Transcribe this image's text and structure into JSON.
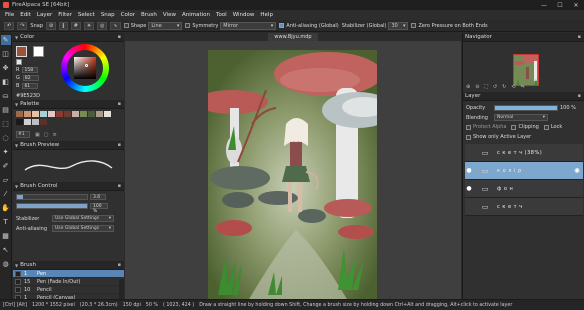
{
  "window": {
    "title": "FireAlpaca SE [64bit]",
    "minimize": "—",
    "maximize": "☐",
    "close": "✕"
  },
  "menu": [
    "File",
    "Edit",
    "Layer",
    "Filter",
    "Select",
    "Snap",
    "Color",
    "Brush",
    "View",
    "Animation",
    "Tool",
    "Window",
    "Help"
  ],
  "toolbar": {
    "snap_label": "Snap",
    "shape_label": "Shape",
    "shape_value": "Line",
    "symmetry_label": "Symmetry",
    "symmetry_value": "Mirror",
    "antialias_label": "Anti-aliasing (Global)",
    "stabilizer_label": "Stabilizer (Global)",
    "stabilizer_value": "30",
    "zero_pressure_label": "Zero Pressure on Both Ends"
  },
  "color_panel": {
    "title": "Color",
    "r_label": "R",
    "r_value": "158",
    "g_label": "G",
    "g_value": "82",
    "b_label": "B",
    "b_value": "61",
    "hex": "#9E523D",
    "fg_color": "#9e523d",
    "bg_color": "#ffffff"
  },
  "palette_panel": {
    "title": "Palette",
    "select_value": "#1",
    "row1": [
      "#9b6a4a",
      "#c99574",
      "#e8c3a6",
      "#a5d1d9",
      "#e3c7c2",
      "#8a3a33",
      "#6b3d2e",
      "#c6b0a8",
      "#7a8a55",
      "#4a5a3a",
      "#a89b8a",
      "#e6e1da"
    ],
    "row2": [
      "#1a1a1a",
      "#d0d0d0",
      "#bfbfbf",
      "#5b2f2a"
    ]
  },
  "brush_preview": {
    "title": "Brush Preview"
  },
  "brush_control": {
    "title": "Brush Control",
    "size_value": "3.6",
    "opacity_value": "100 %",
    "stabilizer_label": "Stabilizer",
    "stabilizer_value": "Use Global Settings",
    "antialias_label": "Anti-aliasing",
    "antialias_value": "Use Global Settings"
  },
  "brush_panel": {
    "title": "Brush",
    "items": [
      {
        "size": "1",
        "name": "Pen",
        "selected": true
      },
      {
        "size": "15",
        "name": "Pen (Fade In/Out)",
        "selected": false
      },
      {
        "size": "10",
        "name": "Pencil",
        "selected": false
      },
      {
        "size": "1",
        "name": "Pencil (Canvas)",
        "selected": false
      }
    ]
  },
  "canvas": {
    "tab_label": "www.Bjyu.mdp"
  },
  "navigator": {
    "title": "Navigator"
  },
  "layer_panel": {
    "title": "Layer",
    "opacity_label": "Opacity",
    "opacity_value": "100 %",
    "blending_label": "Blending",
    "blending_value": "Normal",
    "protect_alpha_label": "Protect Alpha",
    "clipping_label": "Clipping",
    "lock_label": "Lock",
    "show_only_active_label": "Show only Active Layer",
    "layers": [
      {
        "name": "с к е т ч  (38%)",
        "visible": false,
        "selected": false
      },
      {
        "name": "к о л і р",
        "visible": true,
        "selected": true
      },
      {
        "name": "ф о н",
        "visible": true,
        "selected": false
      },
      {
        "name": "с к е т ч",
        "visible": false,
        "selected": false
      }
    ]
  },
  "status": {
    "shortcut": "[Ctrl] [Alt]",
    "dimensions": "1200 * 1552 pixel",
    "size_cm": "(20.3 * 26.3cm)",
    "dpi": "150 dpi",
    "zoom": "50 %",
    "coords": "( 1023, 424 )",
    "hint": "Draw a straight line by holding down Shift, Change a brush size by holding down Ctrl+Alt and dragging, Alt+click to activate layer"
  }
}
